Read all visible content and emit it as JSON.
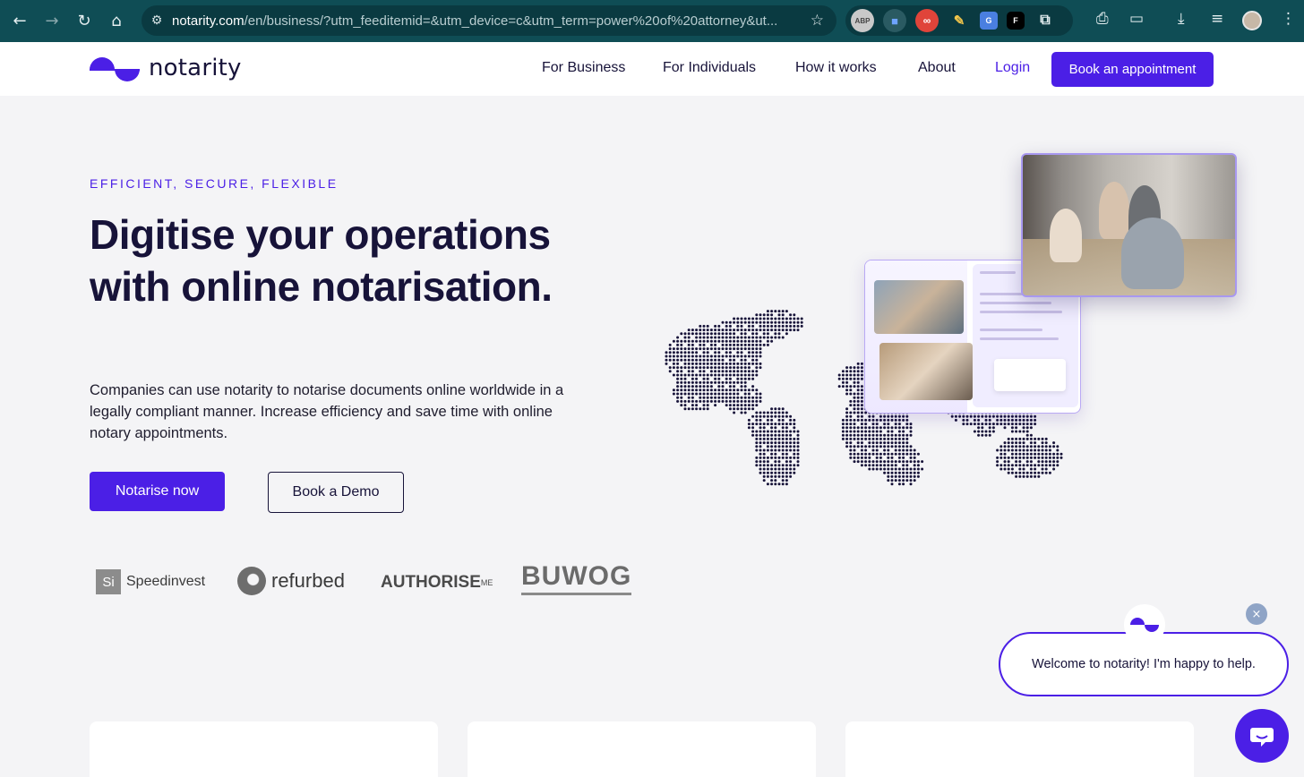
{
  "browser": {
    "url_domain": "notarity.com",
    "url_rest": "/en/business/?utm_feeditemid=&utm_device=c&utm_term=power%20of%20attorney&ut...",
    "extensions": [
      "ABP",
      "camera-icon",
      "infinity-icon",
      "pen-icon",
      "translate-icon",
      "framer-icon",
      "puzzle-icon"
    ]
  },
  "header": {
    "logo_text": "notarity",
    "menu": [
      "For Business",
      "For Individuals",
      "How it works",
      "About"
    ],
    "login": "Login",
    "cta": "Book an appointment"
  },
  "hero": {
    "eyebrow": "EFFICIENT, SECURE, FLEXIBLE",
    "headline": "Digitise your operations with online notarisation.",
    "copy": "Companies can use notarity to notarise documents online worldwide in a legally compliant manner. Increase efficiency and save time with online notary appointments.",
    "primary_button": "Notarise now",
    "secondary_button": "Book a Demo"
  },
  "partners": {
    "speedinvest_mark": "Si",
    "speedinvest": "Speedinvest",
    "refurbed": "refurbed",
    "authoriseme": "AUTHORISE",
    "authoriseme_sup": "ME",
    "buwog": "BUWOG"
  },
  "chat": {
    "message": "Welcome to notarity! I'm happy to help.",
    "close": "×"
  },
  "colors": {
    "brand": "#4b1fe6",
    "ink": "#171339",
    "chrome": "#0f4d55"
  }
}
